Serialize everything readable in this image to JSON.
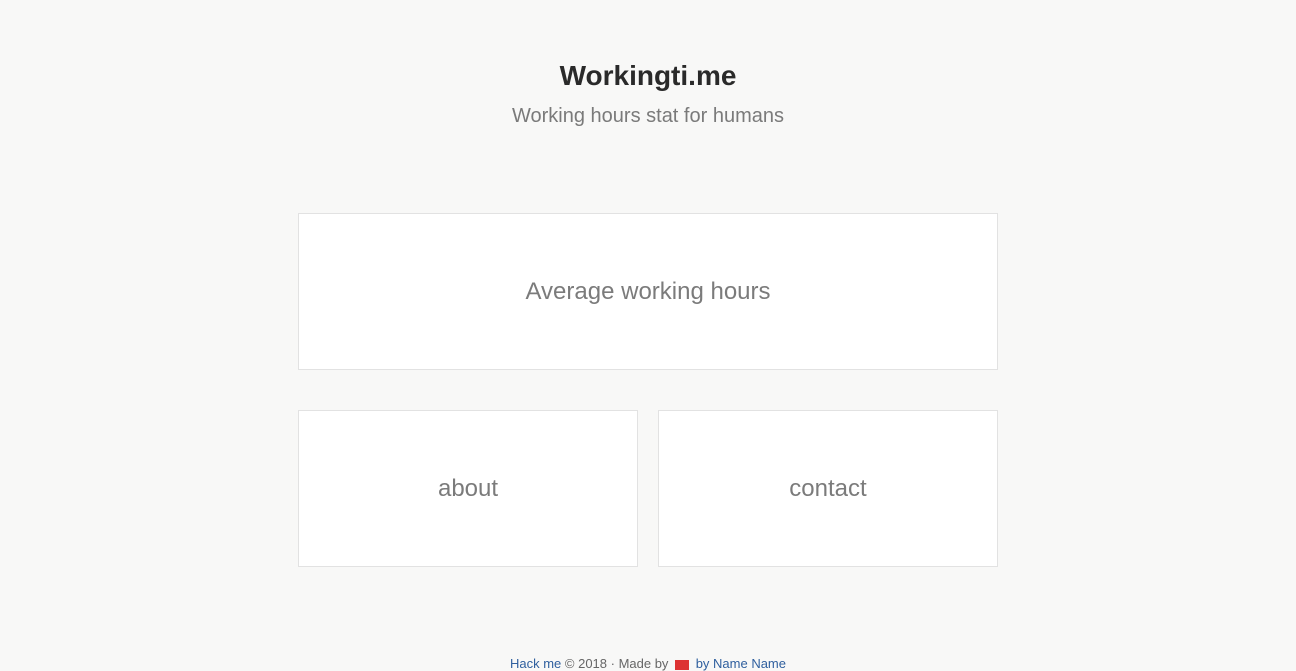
{
  "header": {
    "title": "Workingti.me",
    "subtitle": "Working hours stat for humans"
  },
  "cards": {
    "average": "Average working hours",
    "about": "about",
    "contact": "contact"
  },
  "footer": {
    "source_link": "Hack me",
    "copyright": "© 2018 · Made by",
    "heart_icon": "heart-icon",
    "heart_color": "#dd3333",
    "author_link": "by Name Name"
  },
  "colors": {
    "background": "#f8f8f7",
    "card_background": "#ffffff",
    "card_border": "#e2e2e2",
    "title": "#2a2a2a",
    "muted_text": "#7b7b7b"
  }
}
